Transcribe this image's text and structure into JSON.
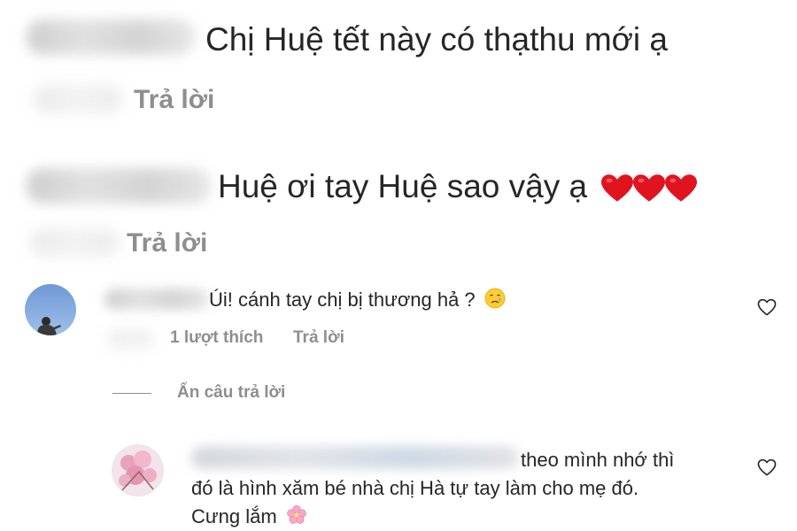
{
  "comments": [
    {
      "text": "Chị Huệ tết này có thạthu mới ạ",
      "reply_label": "Trả lời"
    },
    {
      "text": "Huệ ơi tay Huệ sao vậy ạ",
      "reply_label": "Trả lời",
      "emoji": "red-heart x3"
    },
    {
      "text": "Úi! cánh tay chị bị thương hả ?",
      "emoji": "crying-face",
      "likes_label": "1 lượt thích",
      "reply_label": "Trả lời"
    }
  ],
  "hide_replies_label": "Ẩn câu trả lời",
  "reply": {
    "line1": "theo mình nhớ thì",
    "line2": "đó là hình xăm bé nhà chị Hà tự tay làm cho mẹ đó.",
    "line3": "Cưng lắm",
    "emoji": "cherry-blossom"
  },
  "colors": {
    "text": "#262626",
    "secondary": "#8e8e8e",
    "heart_red": "#e0141e"
  }
}
